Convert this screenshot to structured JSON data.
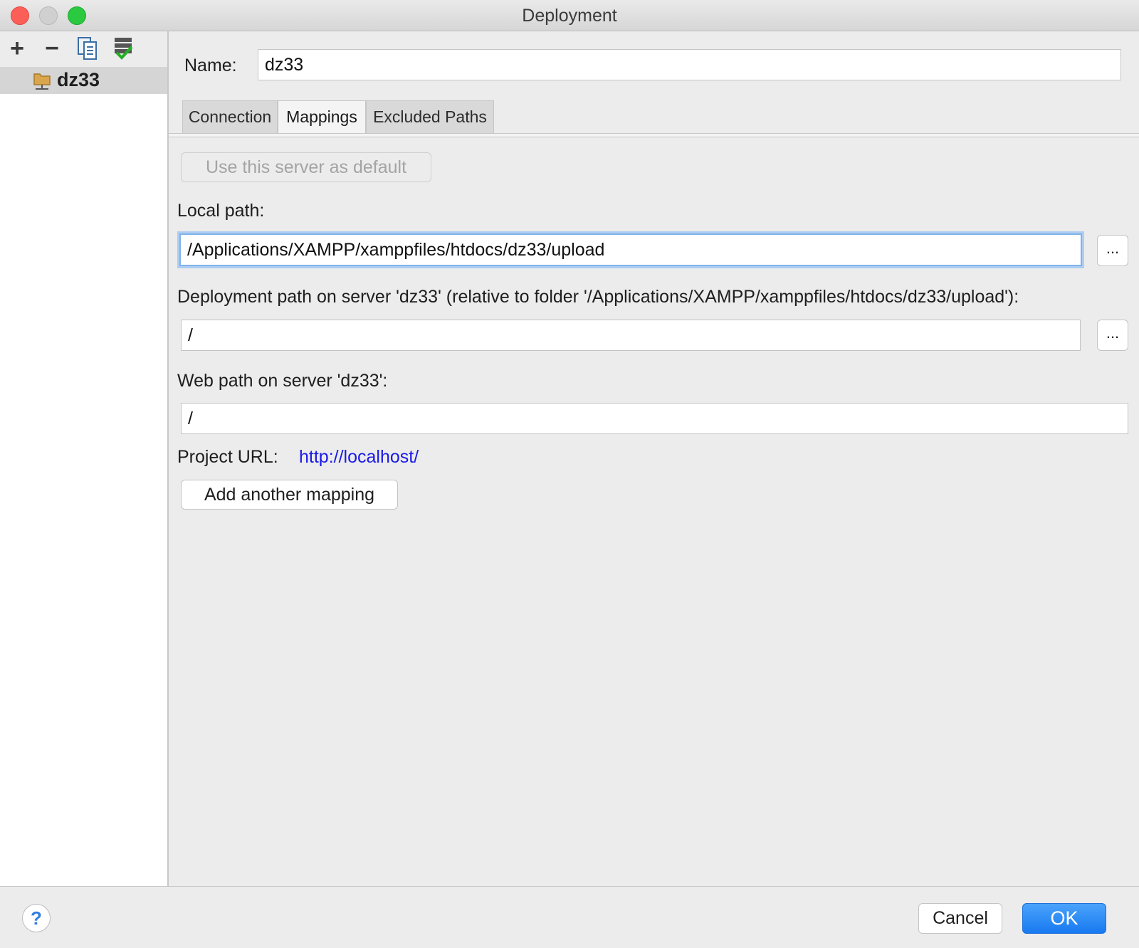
{
  "window": {
    "title": "Deployment"
  },
  "toolbar": {
    "add_icon": "plus-icon",
    "remove_icon": "minus-icon",
    "copy_icon": "copy-icon",
    "default_icon": "use-as-default-icon",
    "add_glyph": "+",
    "remove_glyph": "−"
  },
  "servers": [
    {
      "name": "dz33",
      "icon": "sftp-server-icon",
      "selected": true
    }
  ],
  "name_field": {
    "label": "Name:",
    "value": "dz33"
  },
  "tabs": [
    {
      "label": "Connection",
      "active": false
    },
    {
      "label": "Mappings",
      "active": true
    },
    {
      "label": "Excluded Paths",
      "active": false
    }
  ],
  "mappings": {
    "default_button": "Use this server as default",
    "local_path_label": "Local path:",
    "local_path_value": "/Applications/XAMPP/xamppfiles/htdocs/dz33/upload",
    "deployment_path_label": "Deployment path on server 'dz33' (relative to folder '/Applications/XAMPP/xamppfiles/htdocs/dz33/upload'):",
    "deployment_path_value": "/",
    "web_path_label": "Web path on server 'dz33':",
    "web_path_value": "/",
    "project_url_label": "Project URL:",
    "project_url_value": "http://localhost/",
    "add_mapping_button": "Add another mapping",
    "browse_label": "..."
  },
  "footer": {
    "help_label": "?",
    "cancel_label": "Cancel",
    "ok_label": "OK"
  },
  "colors": {
    "accent": "#1879f0",
    "link": "#1a1ae6",
    "close": "#fc5f57",
    "maximize": "#2ac940"
  }
}
